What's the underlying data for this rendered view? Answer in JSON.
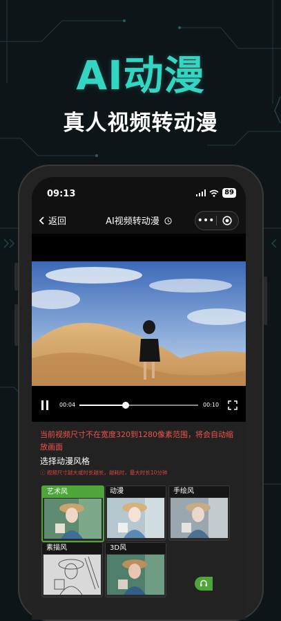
{
  "hero": {
    "title": "AI动漫",
    "subtitle": "真人视频转动漫"
  },
  "status_bar": {
    "time": "09:13",
    "battery": "89"
  },
  "nav": {
    "back_label": "返回",
    "title": "AI视频转动漫",
    "back_icon": "chevron-left-icon",
    "clock_icon": "clock-icon",
    "more_icon": "more-dots-icon",
    "record_icon": "record-icon"
  },
  "player": {
    "current_time": "00:04",
    "duration": "00:10",
    "progress": 0.39,
    "play_icon": "pause-icon",
    "fullscreen_icon": "fullscreen-icon"
  },
  "warning_text": "当前视频尺寸不在宽度320到1280像素范围，将会自动缩放画面",
  "style_section": {
    "title": "选择动漫风格",
    "note": "ⓘ 视频尺寸越大或时长越长，越耗时，最大时长10分钟",
    "styles": [
      {
        "label": "艺术风",
        "selected": true
      },
      {
        "label": "动漫",
        "selected": false
      },
      {
        "label": "手绘风",
        "selected": false
      },
      {
        "label": "素描风",
        "selected": false
      },
      {
        "label": "3D风",
        "selected": false
      }
    ]
  },
  "colors": {
    "accent": "#33d6c3",
    "green": "#4ea53a",
    "warning": "#f1544d"
  }
}
